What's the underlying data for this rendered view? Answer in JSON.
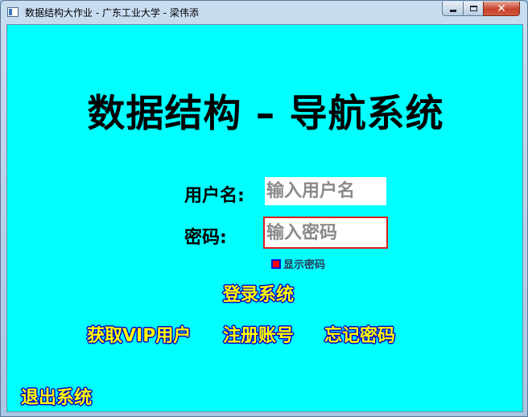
{
  "window": {
    "title": "数据结构大作业 - 广东工业大学 - 梁伟添",
    "controls": {
      "minimize": "minimize-icon",
      "maximize": "maximize-icon",
      "close": "close-icon"
    }
  },
  "main": {
    "heading": "数据结构 – 导航系统",
    "username_label": "用户名:",
    "username_placeholder": "输入用户名",
    "username_value": "",
    "password_label": "密码:",
    "password_placeholder": "输入密码",
    "password_value": "",
    "show_password_label": "显示密码",
    "show_password_checked": false
  },
  "actions": {
    "login": "登录系统",
    "get_vip": "获取VIP用户",
    "register": "注册账号",
    "forgot_password": "忘记密码",
    "exit": "退出系统"
  },
  "colors": {
    "background": "#00ffff",
    "link_text": "#ffff00",
    "link_outline": "#0000cc",
    "focus_border": "#d81e1e"
  }
}
